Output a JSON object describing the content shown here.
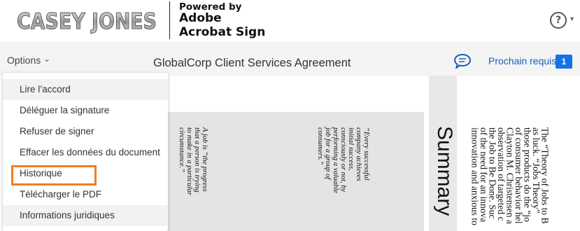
{
  "header": {
    "logo_text": "CASEY JONES",
    "powered_by": "Powered by",
    "brand_line1": "Adobe",
    "brand_line2": "Acrobat Sign",
    "help_icon": "?",
    "help_caret": "▾"
  },
  "toolbar": {
    "options_label": "Options",
    "options_chevron": "⌄",
    "document_title": "GlobalCorp Client Services Agreement",
    "next_required_label": "Prochain requis",
    "next_required_count": "1"
  },
  "menu": {
    "items": [
      {
        "label": "Lire l’accord",
        "highlighted": true
      },
      {
        "label": "Déléguer la signature",
        "highlighted": false
      },
      {
        "label": "Refuser de signer",
        "highlighted": false
      },
      {
        "label": "Effacer les données du document",
        "highlighted": false
      },
      {
        "label": "Historique",
        "highlighted": false,
        "annotated": true
      },
      {
        "label": "Télécharger le PDF",
        "highlighted": false
      },
      {
        "label": "Informations juridiques",
        "highlighted": true
      }
    ]
  },
  "document": {
    "quote1": [
      "A job is “the progress",
      "that a person is trying",
      "to make in a particular",
      "circumstance.”"
    ],
    "quote2": [
      "“Every successful",
      "company achieves",
      "initial success,",
      "consciously or not, by",
      "performing a valuable",
      "job for a group of",
      "consumers.”"
    ],
    "summary_heading": "Summary",
    "body_lines": [
      "The “Theory of Jobs to B",
      "as luck. “Jobs Theory” ",
      "those products do the “jo",
      "of consumer behavior hel",
      "Clayton M. Christensen a",
      "observation of targeted c",
      "the Job to Be Done. Suc",
      "of the need for an innova",
      "innovation and anxious to"
    ]
  },
  "colors": {
    "accent_blue": "#1473e6",
    "link_blue": "#1b5fb5",
    "annotation_orange": "#f47c20"
  }
}
